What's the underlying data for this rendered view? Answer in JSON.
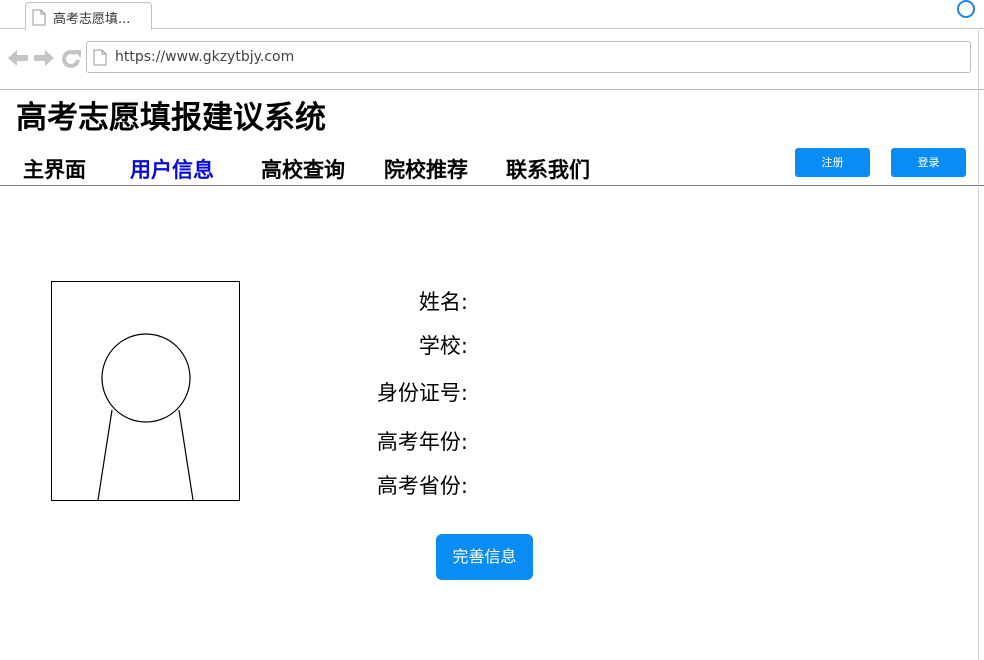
{
  "browser": {
    "tab_title": "高考志愿填...",
    "url": "https://www.gkzytbjy.com"
  },
  "site": {
    "title": "高考志愿填报建议系统"
  },
  "nav": {
    "items": [
      {
        "label": "主界面",
        "active": false
      },
      {
        "label": "用户信息",
        "active": true
      },
      {
        "label": "高校查询",
        "active": false
      },
      {
        "label": "院校推荐",
        "active": false
      },
      {
        "label": "联系我们",
        "active": false
      }
    ],
    "register_label": "注册",
    "login_label": "登录"
  },
  "profile": {
    "fields": [
      {
        "label": "姓名:"
      },
      {
        "label": "学校:"
      },
      {
        "label": "身份证号:"
      },
      {
        "label": "高考年份:"
      },
      {
        "label": "高考省份:"
      }
    ],
    "submit_label": "完善信息"
  },
  "colors": {
    "accent": "#0a8cf5",
    "active_nav": "#0a0ad8"
  }
}
